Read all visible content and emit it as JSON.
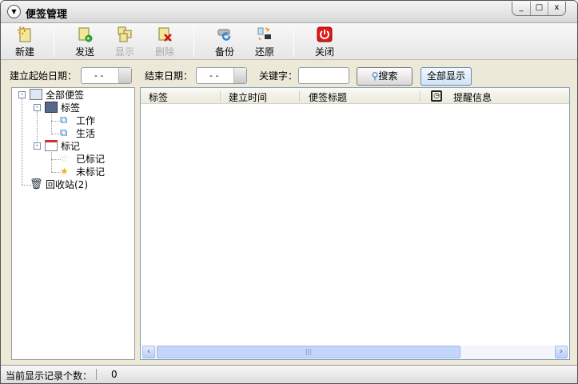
{
  "title": "便签管理",
  "window_controls": {
    "minimize": "_",
    "maximize": "□",
    "close": "x"
  },
  "toolbar": {
    "new": "新建",
    "send": "发送",
    "show": "显示",
    "delete": "删除",
    "backup": "备份",
    "restore": "还原",
    "close": "关闭"
  },
  "filter": {
    "start_label": "建立起始日期：",
    "start_value": "- -",
    "end_label": "结束日期：",
    "end_value": "- -",
    "keyword_label": "关键字：",
    "keyword_value": "",
    "search": "搜索",
    "show_all": "全部显示"
  },
  "tree": {
    "all": "全部便签",
    "tags": "标签",
    "work": "工作",
    "life": "生活",
    "marks": "标记",
    "marked": "已标记",
    "unmarked": "未标记",
    "trash": "回收站(2)"
  },
  "columns": [
    "标签",
    "建立时间",
    "便签标题",
    "提醒信息"
  ],
  "status": {
    "label": "当前显示记录个数：",
    "count": "0"
  },
  "scrollbar": {
    "grip": "|||"
  }
}
